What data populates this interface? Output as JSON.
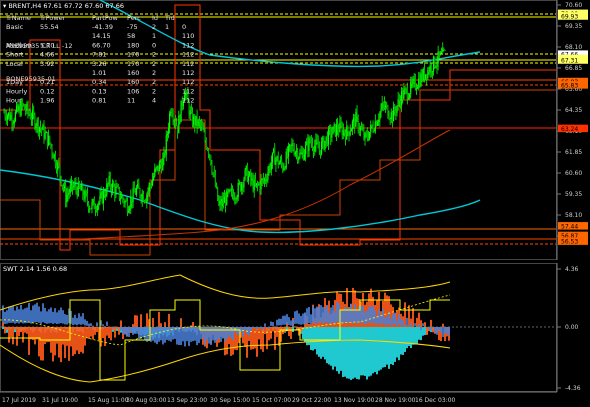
{
  "main_header": "▾ BRENT,H4  67.61 67.72 67.60 67.66",
  "panel_table": {
    "columns": [
      "TrName",
      "TrPower",
      "PartPow",
      "Perc",
      "Id",
      "Tid",
      ""
    ],
    "rows": [
      [
        "Basic",
        "55.54",
        "-41.39",
        "-75",
        "2",
        "1",
        "0"
      ],
      [
        "",
        "",
        "14.15",
        "58",
        "1",
        "",
        "110"
      ],
      [
        "Medium",
        "5.70",
        "66.70",
        "180",
        "0",
        "",
        "112"
      ],
      [
        "Short",
        "4.66",
        "7.81",
        "170",
        "2",
        "",
        "112"
      ],
      [
        "Local",
        "3.92",
        "3.26",
        "170",
        "2",
        "",
        "112"
      ],
      [
        "",
        "",
        "1.01",
        "160",
        "2",
        "",
        "112"
      ],
      [
        "1Day",
        "0.21",
        "0.34",
        "160",
        "2",
        "",
        "112"
      ],
      [
        "Hourly",
        "0.12",
        "0.13",
        "106",
        "2",
        "",
        "112"
      ],
      [
        "Hour",
        "1.96",
        "0.81",
        "11",
        "4",
        "",
        "112"
      ]
    ],
    "overlay_a": "ASE95935 CR LL -12",
    "overlay_b": "BONE95935-01"
  },
  "price_axis": {
    "ticks": [
      "70.60",
      "69.35",
      "68.10",
      "66.85",
      "65.60",
      "64.35",
      "63.10",
      "61.85",
      "60.60",
      "59.35",
      "58.10",
      "56.85"
    ]
  },
  "price_labels": [
    {
      "text": "70.09",
      "color": "#ffff66"
    },
    {
      "text": "69.93",
      "color": "#ffff66"
    },
    {
      "text": "67.66",
      "color": "#ffffff"
    },
    {
      "text": "67.41",
      "color": "#ffff66"
    },
    {
      "text": "67.31",
      "color": "#ffff66"
    },
    {
      "text": "66.03",
      "color": "#ff6600"
    },
    {
      "text": "65.83",
      "color": "#ff6600"
    },
    {
      "text": "63.24",
      "color": "#ff3300"
    },
    {
      "text": "57.44",
      "color": "#ff6600"
    },
    {
      "text": "56.87",
      "color": "#ff6600"
    },
    {
      "text": "56.53",
      "color": "#ff6600"
    }
  ],
  "swt_header": "SWT 2.14 1.56 0.68",
  "swt_axis": {
    "ticks": [
      "4.36",
      "0.00",
      "-4.36"
    ]
  },
  "time_axis": {
    "labels": [
      "17 Jul 2019",
      "31 Jul 19:00",
      "15 Aug 11:00",
      "30 Aug 03:00",
      "13 Sep 23:00",
      "30 Sep 15:00",
      "15 Oct 07:00",
      "29 Oct 22:00",
      "13 Nov 19:00",
      "28 Nov 19:00",
      "16 Dec 03:00"
    ]
  },
  "chart_data": {
    "type": "candlestick",
    "symbol": "BRENT",
    "timeframe": "H4",
    "last_bar": {
      "open": 67.61,
      "high": 67.72,
      "low": 67.6,
      "close": 67.66
    },
    "y_axis_labels": [
      70.6,
      69.35,
      68.1,
      66.85,
      65.6,
      64.35,
      63.1,
      61.85,
      60.6,
      59.35,
      58.1,
      56.85
    ],
    "close_path": [
      [
        0,
        64.2
      ],
      [
        4,
        63.9
      ],
      [
        8,
        64.6
      ],
      [
        12,
        64.0
      ],
      [
        16,
        63.3
      ],
      [
        20,
        62.4
      ],
      [
        24,
        60.8
      ],
      [
        27,
        59.2
      ],
      [
        30,
        59.8
      ],
      [
        34,
        59.5
      ],
      [
        38,
        58.6
      ],
      [
        42,
        58.9
      ],
      [
        46,
        60.0
      ],
      [
        50,
        59.4
      ],
      [
        54,
        58.7
      ],
      [
        58,
        59.6
      ],
      [
        62,
        59.2
      ],
      [
        66,
        60.6
      ],
      [
        70,
        61.4
      ],
      [
        73,
        64.6
      ],
      [
        76,
        63.3
      ],
      [
        79,
        65.6
      ],
      [
        82,
        63.8
      ],
      [
        86,
        63.4
      ],
      [
        90,
        61.8
      ],
      [
        94,
        58.6
      ],
      [
        98,
        59.2
      ],
      [
        102,
        59.5
      ],
      [
        106,
        60.6
      ],
      [
        110,
        59.7
      ],
      [
        114,
        60.2
      ],
      [
        118,
        61.6
      ],
      [
        122,
        61.0
      ],
      [
        126,
        62.2
      ],
      [
        130,
        61.6
      ],
      [
        134,
        62.5
      ],
      [
        138,
        62.0
      ],
      [
        142,
        62.8
      ],
      [
        146,
        63.3
      ],
      [
        150,
        63.0
      ],
      [
        154,
        63.8
      ],
      [
        158,
        62.6
      ],
      [
        162,
        63.5
      ],
      [
        166,
        64.6
      ],
      [
        170,
        64.0
      ],
      [
        174,
        65.2
      ],
      [
        178,
        65.6
      ],
      [
        182,
        66.2
      ],
      [
        186,
        66.8
      ],
      [
        190,
        67.4
      ],
      [
        193,
        67.66
      ]
    ],
    "swt": {
      "values": [
        2.14,
        1.56,
        0.68
      ],
      "ylim": [
        -4.36,
        4.36
      ]
    }
  }
}
